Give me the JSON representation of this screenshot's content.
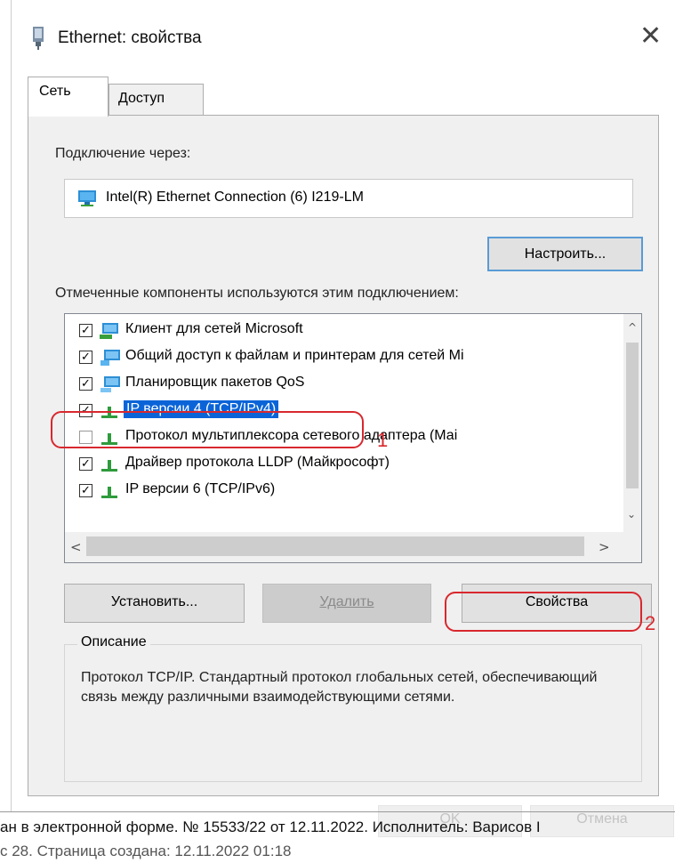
{
  "window": {
    "title": "Ethernet: свойства",
    "close_glyph": "✕",
    "icon": "network-adapter-icon"
  },
  "tabs": [
    {
      "label": "Сеть",
      "active": true
    },
    {
      "label": "Доступ",
      "active": false
    }
  ],
  "connection": {
    "label": "Подключение через:",
    "adapter": "Intel(R) Ethernet Connection (6) I219-LM",
    "configure_button": "Настроить..."
  },
  "components": {
    "label": "Отмеченные компоненты используются этим подключением:",
    "items": [
      {
        "checked": true,
        "icon": "client-icon",
        "label": "Клиент для сетей Microsoft"
      },
      {
        "checked": true,
        "icon": "share-icon",
        "label": "Общий доступ к файлам и принтерам для сетей Mi"
      },
      {
        "checked": true,
        "icon": "scheduler-icon",
        "label": "Планировщик пакетов QoS"
      },
      {
        "checked": true,
        "icon": "protocol-icon",
        "label": "IP версии 4 (TCP/IPv4)",
        "selected": true
      },
      {
        "checked": false,
        "icon": "protocol-icon",
        "label": "Протокол мультиплексора сетевого адаптера (Маi"
      },
      {
        "checked": true,
        "icon": "protocol-icon",
        "label": "Драйвер протокола LLDP (Майкрософт)"
      },
      {
        "checked": true,
        "icon": "protocol-icon",
        "label": "IP версии 6 (TCP/IPv6)"
      }
    ],
    "check_glyph": "✓"
  },
  "scroll": {
    "up": "^",
    "down": "⌄",
    "left": "<",
    "right": ">"
  },
  "buttons": {
    "install": "Установить...",
    "remove": "Удалить",
    "properties": "Свойства"
  },
  "description": {
    "legend": "Описание",
    "text": "Протокол TCP/IP. Стандартный протокол глобальных сетей, обеспечивающий связь между различными взаимодействующими сетями."
  },
  "annotations": {
    "one": "1",
    "two": "2",
    "color": "#d8282e"
  },
  "dialog_buttons": {
    "ok": "OK",
    "cancel": "Отмена"
  },
  "footer": {
    "line1": "ан в электронной форме. № 15533/22 от 12.11.2022. Исполнитель: Варисов I",
    "line2": "с 28. Страница создана: 12.11.2022 01:18"
  }
}
